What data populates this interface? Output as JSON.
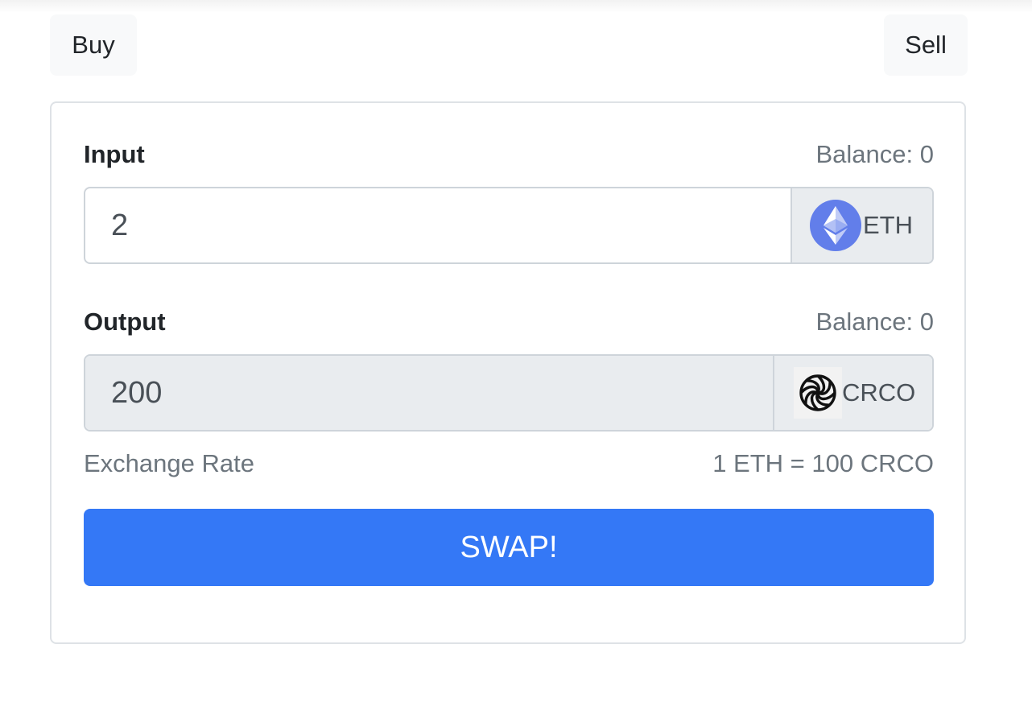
{
  "tabs": {
    "buy_label": "Buy",
    "sell_label": "Sell"
  },
  "input": {
    "label": "Input",
    "balance": "Balance: 0",
    "amount": "2",
    "token": "ETH",
    "token_icon": "ethereum-icon"
  },
  "output": {
    "label": "Output",
    "balance": "Balance: 0",
    "amount": "200",
    "token": "CRCO",
    "token_icon": "crco-logo-icon"
  },
  "exchange": {
    "label": "Exchange Rate",
    "value": "1 ETH = 100 CRCO"
  },
  "swap_button": {
    "label": "SWAP!"
  },
  "colors": {
    "primary": "#3478f6",
    "eth": "#627eea",
    "muted": "#6c757d"
  }
}
